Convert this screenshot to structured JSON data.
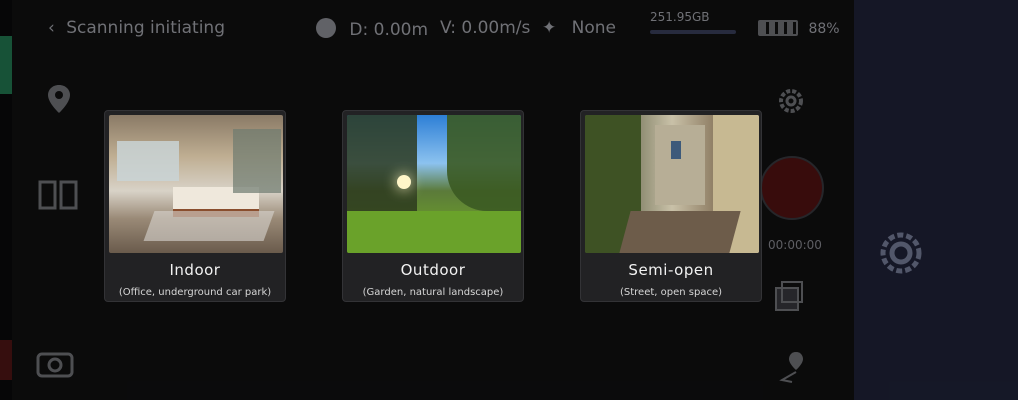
{
  "topbar": {
    "status": "Scanning initiating",
    "distance": "D: 0.00m",
    "velocity": "V: 0.00m/s",
    "signal": "None",
    "storage": "251.95GB",
    "battery": "88%"
  },
  "recording": {
    "time": "00:00:00"
  },
  "modal": {
    "cards": [
      {
        "title": "Indoor",
        "subtitle": "(Office, underground car park)"
      },
      {
        "title": "Outdoor",
        "subtitle": "(Garden, natural landscape)"
      },
      {
        "title": "Semi-open",
        "subtitle": "(Street, open space)"
      }
    ]
  }
}
